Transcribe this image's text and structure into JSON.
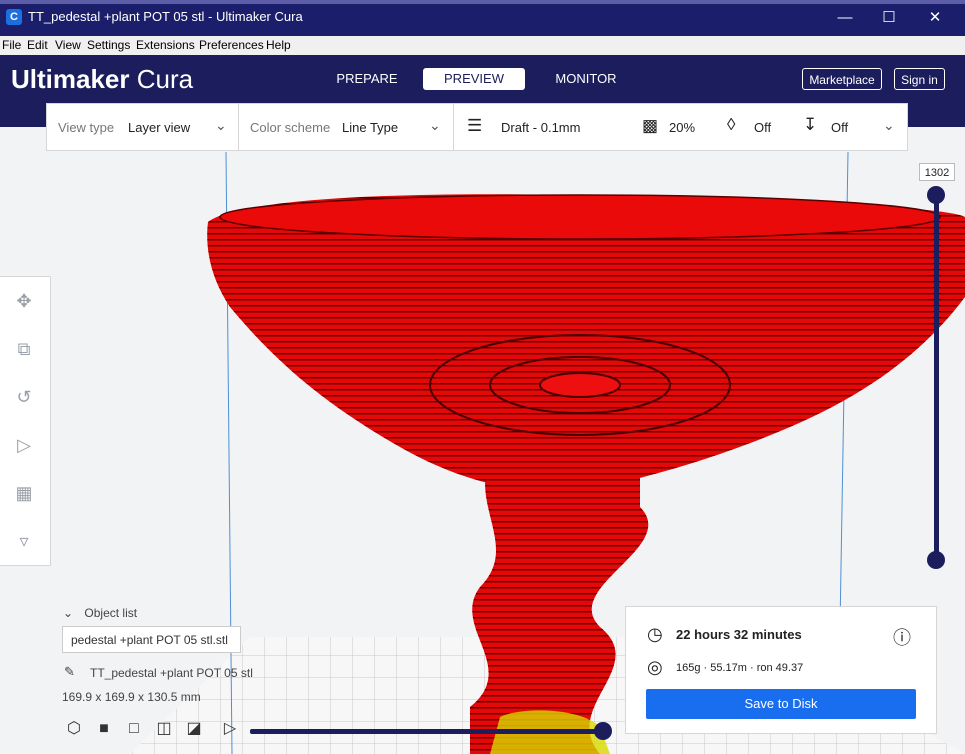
{
  "window": {
    "title": "TT_pedestal +plant POT 05 stl - Ultimaker Cura",
    "app_icon": "C",
    "minimize": "—",
    "maximize": "☐",
    "close": "✕"
  },
  "menu": [
    "File",
    "Edit",
    "View",
    "Settings",
    "Extensions",
    "Preferences",
    "Help"
  ],
  "header": {
    "logo_bold": "Ultimaker",
    "logo_light": "Cura",
    "tabs": [
      "PREPARE",
      "PREVIEW",
      "MONITOR"
    ],
    "active_tab": "PREVIEW",
    "marketplace": "Marketplace",
    "sign_in": "Sign in"
  },
  "toolbar": {
    "view_type_label": "View type",
    "view_type_value": "Layer view",
    "color_scheme_label": "Color scheme",
    "color_scheme_value": "Line Type",
    "profile": "Draft - 0.1mm",
    "infill": "20%",
    "support": "Off",
    "adhesion": "Off"
  },
  "layer_slider": {
    "value": "1302"
  },
  "object_list": {
    "header": "Object list",
    "field_value": "pedestal +plant POT 05 stl.stl",
    "object_name": "TT_pedestal +plant POT 05 stl",
    "dimensions": "169.9 x 169.9 x 130.5 mm"
  },
  "print_info": {
    "time": "22 hours 32 minutes",
    "material": "165g · 55.17m · ron 49.37",
    "save_button": "Save to Disk"
  },
  "colors": {
    "header_bg": "#1b1d5c",
    "model_red": "#e20a0a",
    "accent_blue": "#196ef0"
  }
}
